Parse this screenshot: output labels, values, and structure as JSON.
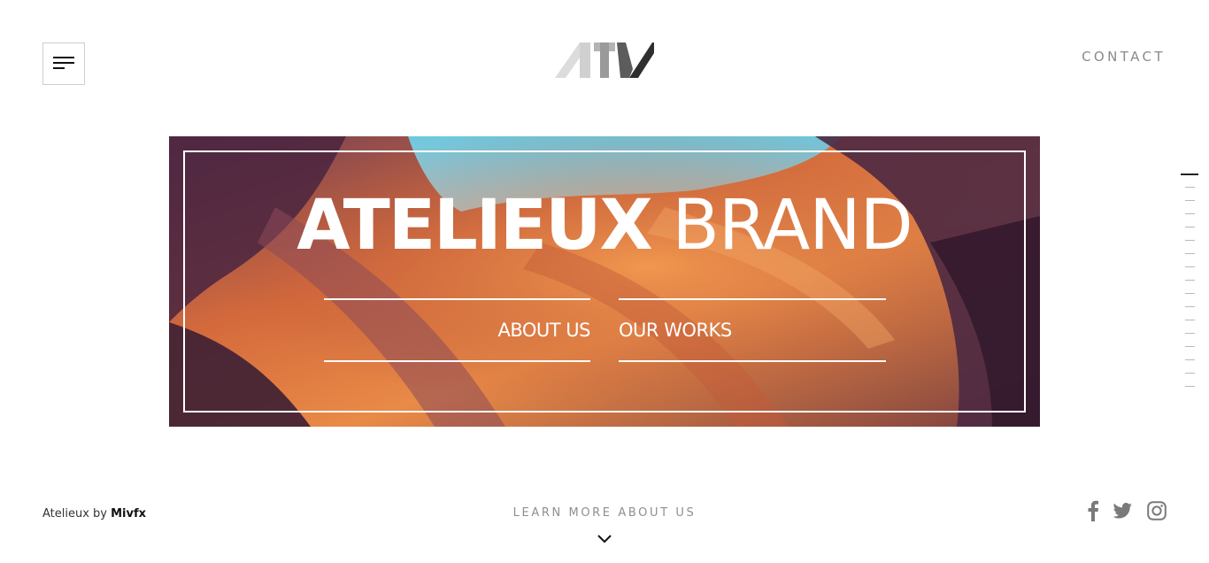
{
  "header": {
    "menu_icon": "hamburger-icon",
    "logo_text": "ATV",
    "contact_label": "CONTACT"
  },
  "hero": {
    "title_bold": "ATELIEUX",
    "title_light": "BRAND",
    "about_label": "ABOUT US",
    "works_label": "OUR WORKS",
    "image": "canyon-photo"
  },
  "side_nav": {
    "count": 17,
    "active_index": 0
  },
  "footer": {
    "credit_prefix": "Atelieux by ",
    "credit_brand": "Mivfx",
    "learn_more": "LEARN MORE ABOUT US",
    "scroll_icon": "chevron-down-icon",
    "socials": [
      "facebook-icon",
      "twitter-icon",
      "instagram-icon"
    ]
  },
  "colors": {
    "accent_dark": "#222222",
    "muted_text": "#8a8a8a"
  }
}
